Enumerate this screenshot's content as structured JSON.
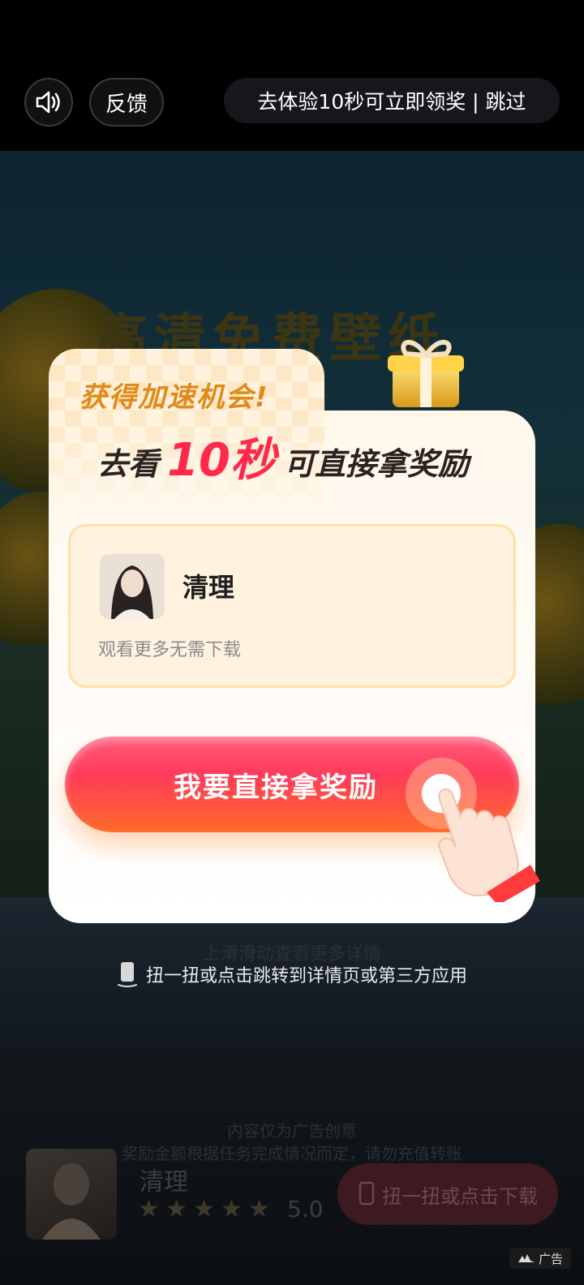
{
  "topbar": {
    "sound_icon": "speaker-volume-icon",
    "feedback_label": "反馈",
    "skip_text": "去体验10秒可立即领奖 | 跳过"
  },
  "background": {
    "title": "高清免费壁纸",
    "swipe_hint": "上滑滑动查看更多详情",
    "disclaimer_1": "内容仅为广告创意",
    "disclaimer_2": "奖励金额根据任务完成情况而定，请勿充值转账"
  },
  "modal": {
    "headline": "获得加速机会!",
    "subline_prefix": "去看",
    "subline_highlight": "10秒",
    "subline_suffix": "可直接拿奖励",
    "app_name": "清理",
    "app_desc": "观看更多无需下载",
    "cta_label": "我要直接拿奖励"
  },
  "shake_hint": "扭一扭或点击跳转到详情页或第三方应用",
  "bottom_bar": {
    "app_name": "清理",
    "rating": "5.0",
    "star_count": 5,
    "download_label": "扭一扭或点击下载"
  },
  "ad_label": "广告",
  "colors": {
    "accent": "#ff3b5a",
    "highlight": "#ffe24a",
    "headline": "#e08a18"
  }
}
